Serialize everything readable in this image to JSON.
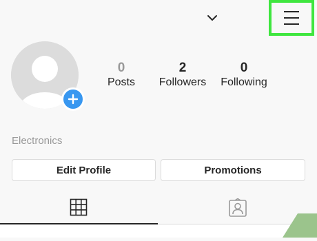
{
  "header": {
    "dropdown_icon": "chevron-down-icon",
    "menu_icon": "hamburger-menu-icon",
    "highlight_color": "#3fe63f"
  },
  "profile": {
    "avatar_icon": "default-avatar",
    "add_badge_icon": "plus-icon",
    "add_badge_color": "#3897f0",
    "stats": {
      "posts": {
        "count": "0",
        "label": "Posts"
      },
      "followers": {
        "count": "2",
        "label": "Followers"
      },
      "following": {
        "count": "0",
        "label": "Following"
      }
    },
    "bio": "Electronics"
  },
  "actions": {
    "edit_profile_label": "Edit Profile",
    "promotions_label": "Promotions"
  },
  "tabs": {
    "grid_icon": "grid-icon",
    "tagged_icon": "tagged-person-icon",
    "active": "grid"
  }
}
